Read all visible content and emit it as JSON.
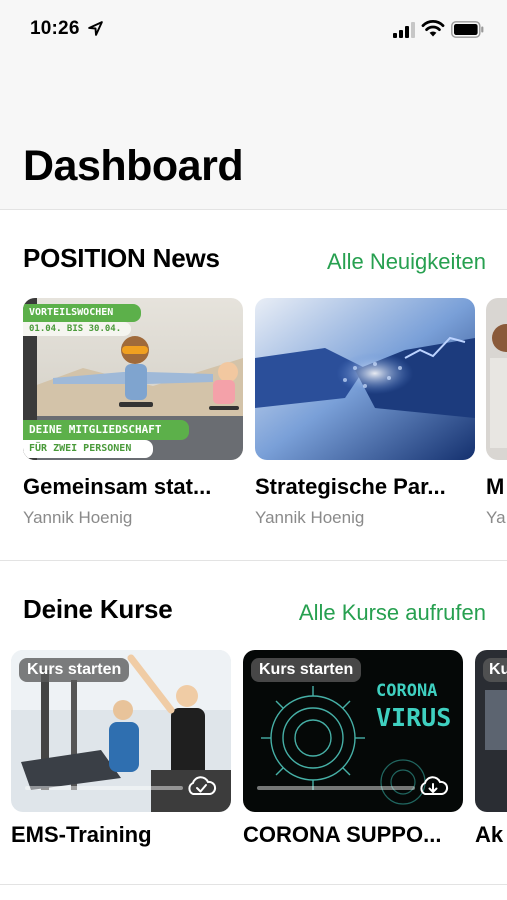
{
  "status_bar": {
    "time": "10:26"
  },
  "page": {
    "title": "Dashboard"
  },
  "news": {
    "title": "POSITION News",
    "link": "Alle Neuigkeiten",
    "cards": [
      {
        "title": "Gemeinsam stat...",
        "author": "Yannik Hoenig",
        "image": {
          "banner_top": "VORTEILSWOCHEN",
          "banner_date": "01.04. BIS 30.04.",
          "banner_main": "DEINE MITGLIEDSCHAFT",
          "banner_sub": "FÜR ZWEI PERSONEN"
        }
      },
      {
        "title": "Strategische Par...",
        "author": "Yannik Hoenig"
      },
      {
        "title": "M",
        "author": "Ya"
      }
    ]
  },
  "courses": {
    "title": "Deine Kurse",
    "link": "Alle Kurse aufrufen",
    "cards": [
      {
        "badge": "Kurs starten",
        "title": "EMS-Training"
      },
      {
        "badge": "Kurs starten",
        "title": "CORONA SUPPO...",
        "image_text_1": "CORONA",
        "image_text_2": "VIRUS"
      },
      {
        "badge": "Kur",
        "title": "Ak"
      }
    ]
  },
  "colors": {
    "accent": "#27a050",
    "badge_bg": "#5a5a5a",
    "banner_green": "#5cb04a"
  }
}
